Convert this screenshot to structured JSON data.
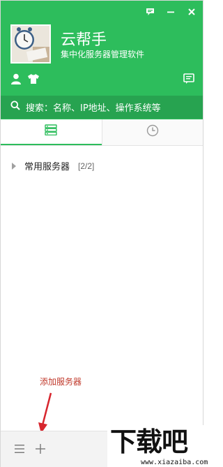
{
  "app": {
    "title": "云帮手",
    "subtitle": "集中化服务器管理软件"
  },
  "search": {
    "placeholder": "搜索：名称、IP地址、操作系统等"
  },
  "tree": {
    "groups": [
      {
        "label": "常用服务器",
        "count": "[2/2]"
      }
    ]
  },
  "annotation": {
    "text": "添加服务器"
  },
  "watermark": {
    "main": "下载吧",
    "url": "www.xiazaiba.com"
  },
  "colors": {
    "brand_green": "#2dbd5c",
    "search_green": "#27a350",
    "annotation_red": "#c0392b"
  },
  "icons": {
    "win_controls": [
      "feedback-icon",
      "minimize-icon",
      "close-icon"
    ],
    "user_row": [
      "user-icon",
      "skin-icon"
    ],
    "tabs": [
      "server-list-icon",
      "history-clock-icon"
    ],
    "bottom": [
      "menu-icon",
      "add-icon"
    ]
  }
}
